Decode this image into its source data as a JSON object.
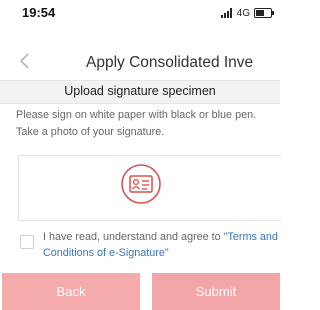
{
  "status_bar": {
    "time": "19:54",
    "network": "4G",
    "battery_level": 0.55
  },
  "header": {
    "title": "Apply Consolidated Inve"
  },
  "section": {
    "title": "Upload signature specimen"
  },
  "instructions": "Please sign on white paper with black or blue pen. Take a photo of your signature.",
  "upload": {
    "icon": "id-card-icon",
    "icon_color": "#d9534f"
  },
  "agreement": {
    "text": "I have read, understand and agree to ",
    "link": "\"Terms and Conditions of e-Signature\"",
    "checked": false
  },
  "buttons": {
    "back": "Back",
    "submit": "Submit"
  },
  "colors": {
    "accent": "#f3a6a8",
    "link": "#3a74b8"
  }
}
